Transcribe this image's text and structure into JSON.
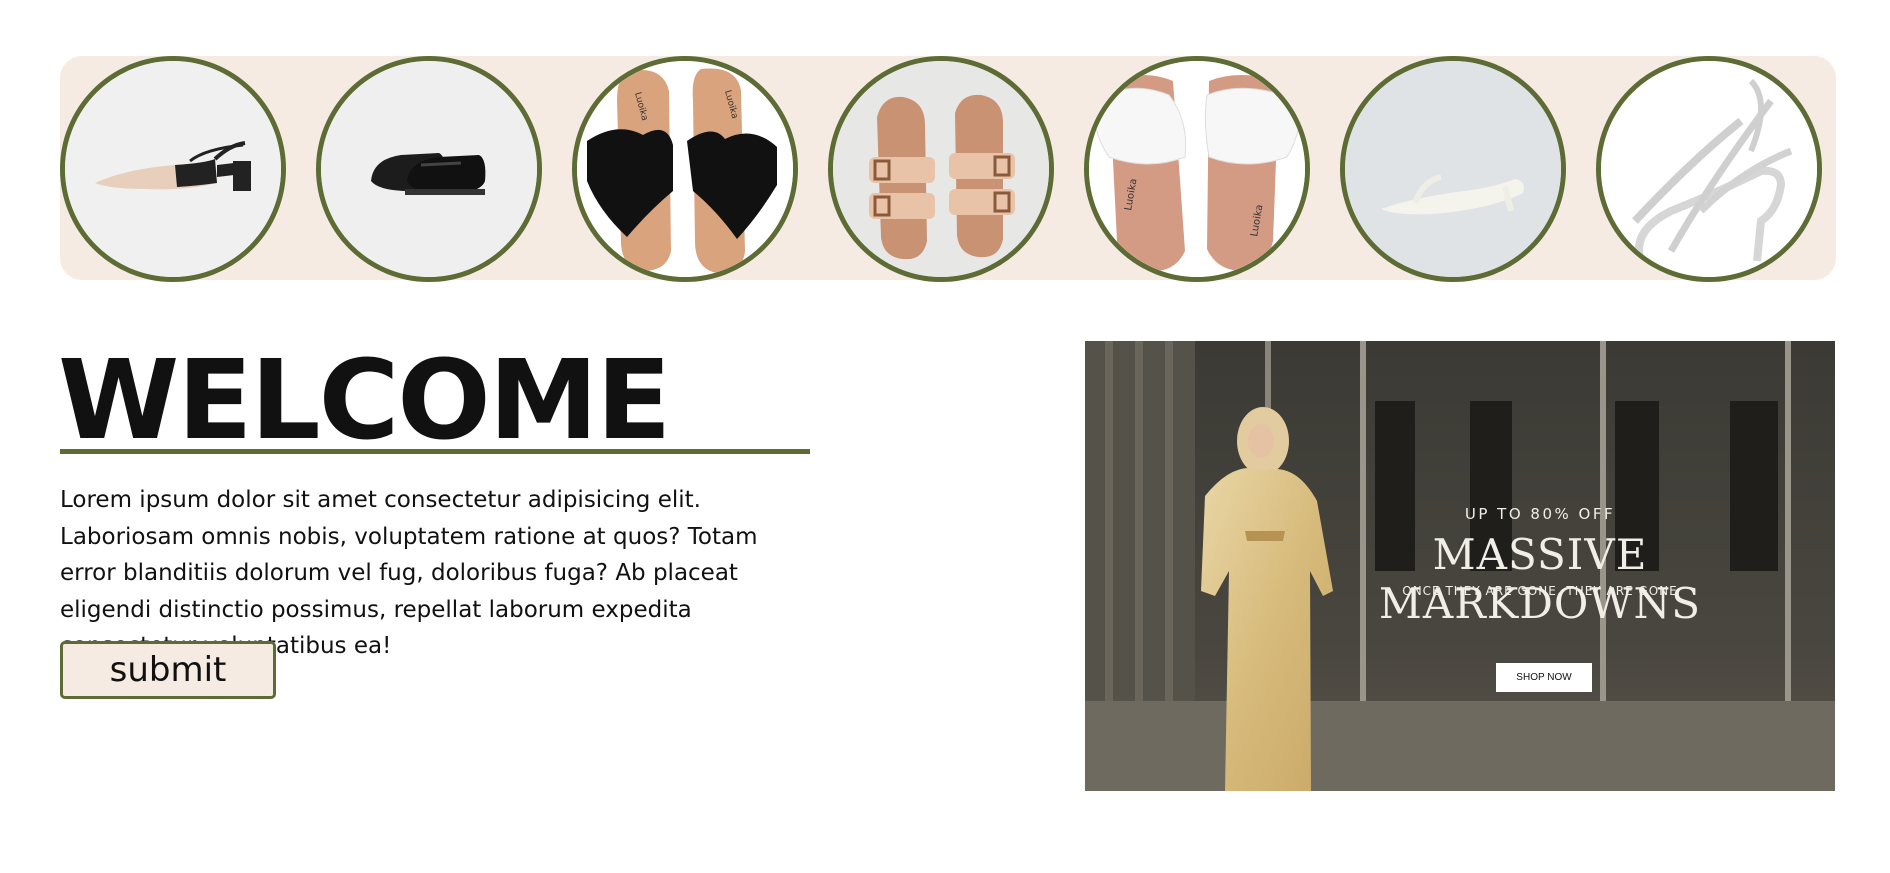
{
  "thumbnails": [
    {
      "name": "slingback-heel",
      "bg": "#f0f0f0"
    },
    {
      "name": "black-loafers",
      "bg": "#efefef"
    },
    {
      "name": "black-lace-flip-flops",
      "bg": "#ffffff",
      "label": "Luoika"
    },
    {
      "name": "buckle-slide-sandals",
      "bg": "#e7e7e6"
    },
    {
      "name": "white-braided-slides",
      "bg": "#ffffff",
      "label": "Luoika"
    },
    {
      "name": "white-kitten-heel-thong",
      "bg": "#dfe3e5"
    },
    {
      "name": "silver-strappy-sandal",
      "bg": "#ffffff"
    }
  ],
  "welcome": {
    "title": "WELCOME",
    "body": "Lorem ipsum dolor sit amet consectetur adipisicing elit. Laboriosam omnis nobis, voluptatem ratione at quos? Totam error blanditiis dolorum vel fug, doloribus fuga? Ab placeat eligendi distinctio possimus, repellat laborum expedita consectetur voluptatibus ea!",
    "submit_label": "submit"
  },
  "banner": {
    "upto": "UP TO 80% OFF",
    "headline": "MASSIVE MARKDOWNS",
    "subline": "ONCE THEY ARE GONE, THEY ARE GONE",
    "cta": "SHOP NOW"
  },
  "colors": {
    "accent": "#5d6b35",
    "strip_bg": "#f5ebe2"
  }
}
